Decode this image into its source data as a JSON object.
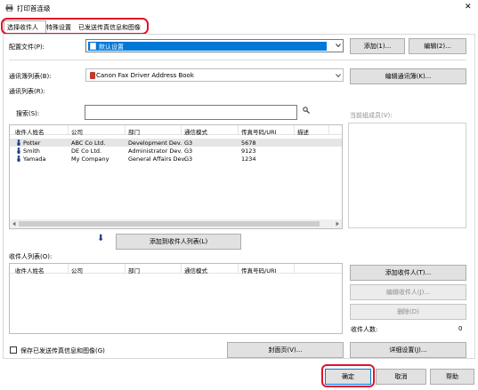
{
  "window": {
    "title": "打印首连级",
    "close_glyph": "✕"
  },
  "tabs": [
    {
      "label": "选择收件人",
      "active": true
    },
    {
      "label": "特殊设置",
      "active": false
    },
    {
      "label": "已发送传真信息和图像",
      "active": false
    }
  ],
  "profile": {
    "label": "配置文件(P):",
    "value": "默认设置",
    "add_button": "添加(1)...",
    "edit_button": "编辑(2)..."
  },
  "address_book": {
    "label": "通讯簿列表(B):",
    "value": "Canon Fax Driver Address Book",
    "edit_button": "编辑通讯簿(K)..."
  },
  "address_list": {
    "label": "通讯列表(R):",
    "search_label": "搜索(S):",
    "search_value": "",
    "current_members_label": "当前组成员(V):",
    "columns": [
      "收件人姓名",
      "公司",
      "部门",
      "通信模式",
      "传真号码/URI",
      "描述"
    ],
    "rows": [
      {
        "name": "Potter",
        "company": "ABC Co Ltd.",
        "dept": "Development Dev.",
        "mode": "G3",
        "fax": "5678",
        "desc": ""
      },
      {
        "name": "Smith",
        "company": "DE Co Ltd.",
        "dept": "Administrator Dev.",
        "mode": "G3",
        "fax": "9123",
        "desc": ""
      },
      {
        "name": "Yamada",
        "company": "My Company",
        "dept": "General Affairs Dev.",
        "mode": "G3",
        "fax": "1234",
        "desc": ""
      }
    ]
  },
  "add_to_list": {
    "arrow": "⬇",
    "button": "添加到收件人列表(L)"
  },
  "recipient_list": {
    "label": "收件人列表(O):",
    "columns": [
      "收件人姓名",
      "公司",
      "部门",
      "通信模式",
      "传真号码/URI"
    ],
    "add_button": "添加收件人(T)...",
    "edit_button": "编辑收件人(J)...",
    "delete_button": "删除(D)",
    "count_label": "收件人数:",
    "count_value": "0"
  },
  "save_info": {
    "label": "保存已发送传真信息和图像(G)",
    "checked": false
  },
  "cover_page_button": "封面页(V)...",
  "details_button": "详细设置(J)...",
  "ok_button": "确定",
  "cancel_button": "取消",
  "help_button": "帮助",
  "colors": {
    "highlight": "#e0142a",
    "selected_blue": "#0078d7",
    "person_icon": "#1f3f8c"
  }
}
